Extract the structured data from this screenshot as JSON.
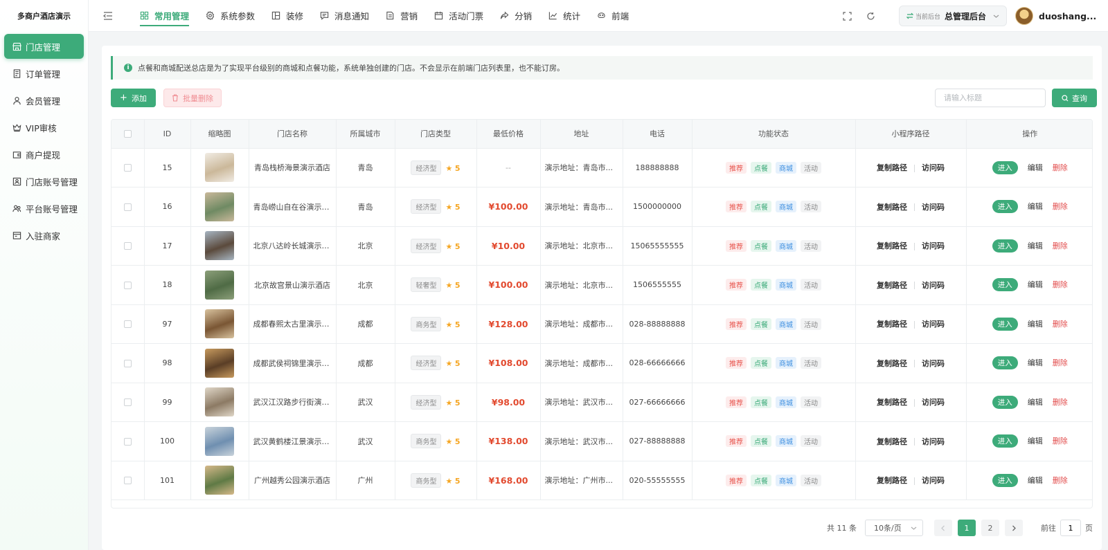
{
  "brand": "多商户酒店演示",
  "sidebar": {
    "items": [
      {
        "label": "门店管理",
        "icon": "store-icon",
        "active": true
      },
      {
        "label": "订单管理",
        "icon": "order-icon"
      },
      {
        "label": "会员管理",
        "icon": "user-icon"
      },
      {
        "label": "VIP审核",
        "icon": "crown-icon"
      },
      {
        "label": "商户提现",
        "icon": "wallet-icon"
      },
      {
        "label": "门店账号管理",
        "icon": "id-card-icon"
      },
      {
        "label": "平台账号管理",
        "icon": "users-icon"
      },
      {
        "label": "入驻商家",
        "icon": "merchant-icon"
      }
    ]
  },
  "topnav": {
    "tabs": [
      {
        "label": "常用管理",
        "icon": "grid-icon",
        "active": true
      },
      {
        "label": "系统参数",
        "icon": "gear-icon"
      },
      {
        "label": "装修",
        "icon": "layout-icon"
      },
      {
        "label": "消息通知",
        "icon": "message-icon"
      },
      {
        "label": "营销",
        "icon": "marketing-icon"
      },
      {
        "label": "活动门票",
        "icon": "calendar-icon"
      },
      {
        "label": "分销",
        "icon": "share-icon"
      },
      {
        "label": "统计",
        "icon": "chart-icon"
      },
      {
        "label": "前端",
        "icon": "globe-icon"
      }
    ],
    "backend_label": "当前后台",
    "backend_value": "总管理后台",
    "username": "duoshang..."
  },
  "notice": "点餐和商城配送总店是为了实现平台级别的商城和点餐功能，系统单独创建的门店。不会显示在前端门店列表里，也不能订房。",
  "toolbar": {
    "add_label": "添加",
    "batch_delete_label": "批量删除",
    "search_placeholder": "请输入标题",
    "query_label": "查询"
  },
  "table": {
    "headers": [
      "ID",
      "缩略图",
      "门店名称",
      "所属城市",
      "门店类型",
      "最低价格",
      "地址",
      "电话",
      "功能状态",
      "小程序路径",
      "操作"
    ],
    "tags": {
      "recommend": "推荐",
      "food": "点餐",
      "mall": "商城",
      "activity": "活动"
    },
    "path_actions": {
      "copy": "复制路径",
      "qrcode": "访问码"
    },
    "ops": {
      "enter": "进入",
      "edit": "编辑",
      "delete": "删除"
    },
    "rows": [
      {
        "id": "15",
        "name": "青岛栈桥海景演示酒店",
        "city": "青岛",
        "type": "经济型",
        "stars": "5",
        "price": "--",
        "address": "演示地址：青岛市...",
        "phone": "188888888",
        "thumb": [
          "#cbb89a",
          "#f1ece4"
        ]
      },
      {
        "id": "16",
        "name": "青岛崂山自在谷演示民宿",
        "city": "青岛",
        "type": "经济型",
        "stars": "5",
        "price": "¥100.00",
        "address": "演示地址：青岛市...",
        "phone": "1500000000",
        "thumb": [
          "#6f8a63",
          "#c9b89a"
        ]
      },
      {
        "id": "17",
        "name": "北京八达岭长城演示度...",
        "city": "北京",
        "type": "经济型",
        "stars": "5",
        "price": "¥10.00",
        "address": "演示地址：北京市...",
        "phone": "15065555555",
        "thumb": [
          "#5b4a3c",
          "#a7b5c2"
        ]
      },
      {
        "id": "18",
        "name": "北京故宫景山演示酒店",
        "city": "北京",
        "type": "轻奢型",
        "stars": "5",
        "price": "¥100.00",
        "address": "演示地址：北京市...",
        "phone": "1506555555",
        "thumb": [
          "#4f6b45",
          "#8c9f7a"
        ]
      },
      {
        "id": "97",
        "name": "成都春熙太古里演示酒店",
        "city": "成都",
        "type": "商务型",
        "stars": "5",
        "price": "¥128.00",
        "address": "演示地址：成都市...",
        "phone": "028-88888888",
        "thumb": [
          "#7a5634",
          "#d8c29e"
        ]
      },
      {
        "id": "98",
        "name": "成都武侯祠锦里演示民宿",
        "city": "成都",
        "type": "经济型",
        "stars": "5",
        "price": "¥108.00",
        "address": "演示地址：成都市...",
        "phone": "028-66666666",
        "thumb": [
          "#5a3e26",
          "#c79a5e"
        ]
      },
      {
        "id": "99",
        "name": "武汉江汉路步行街演示...",
        "city": "武汉",
        "type": "经济型",
        "stars": "5",
        "price": "¥98.00",
        "address": "演示地址：武汉市...",
        "phone": "027-66666666",
        "thumb": [
          "#8c7a64",
          "#e0d7c8"
        ]
      },
      {
        "id": "100",
        "name": "武汉黄鹤楼江景演示酒店",
        "city": "武汉",
        "type": "商务型",
        "stars": "5",
        "price": "¥138.00",
        "address": "演示地址：武汉市...",
        "phone": "027-88888888",
        "thumb": [
          "#6f8fb0",
          "#c9d3db"
        ]
      },
      {
        "id": "101",
        "name": "广州越秀公园演示酒店",
        "city": "广州",
        "type": "商务型",
        "stars": "5",
        "price": "¥168.00",
        "address": "演示地址：广州市...",
        "phone": "020-55555555",
        "thumb": [
          "#5f7a45",
          "#d6b98a"
        ]
      }
    ]
  },
  "pagination": {
    "total": "共 11 条",
    "page_size": "10条/页",
    "pages": [
      "1",
      "2"
    ],
    "current": "1",
    "goto_label": "前往",
    "goto_value": "1",
    "page_suffix": "页"
  },
  "colors": {
    "accent": "#3dab7a",
    "price": "#e24a2f",
    "danger": "#e24a4a"
  }
}
